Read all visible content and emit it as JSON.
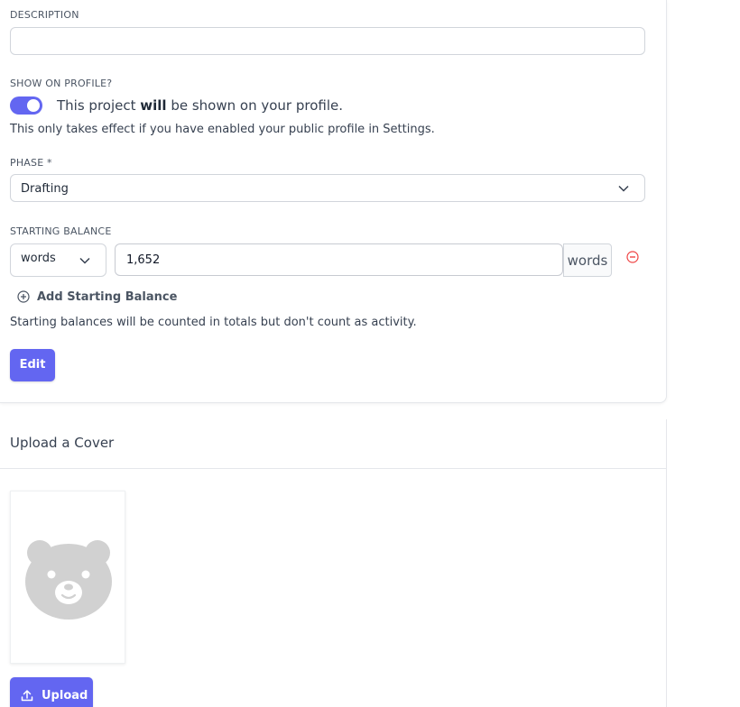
{
  "description": {
    "label": "DESCRIPTION",
    "value": "",
    "placeholder": ""
  },
  "profile": {
    "label": "SHOW ON PROFILE?",
    "toggle_on": true,
    "text_before": "This project",
    "text_bold": "will",
    "text_after": "be shown on your profile.",
    "note": "This only takes effect if you have enabled your public profile in Settings."
  },
  "phase": {
    "label": "PHASE *",
    "value": "Drafting"
  },
  "starting_balance": {
    "label": "STARTING BALANCE",
    "unit": "words",
    "amount": "1,652",
    "addon": "words",
    "add_label": "Add Starting Balance",
    "note": "Starting balances will be counted in totals but don't count as activity."
  },
  "edit_label": "Edit",
  "cover": {
    "title": "Upload a Cover",
    "upload_label": "Upload"
  },
  "colors": {
    "accent": "#6366f1",
    "danger": "#ef4444",
    "placeholder_bear": "#d1d1d1"
  }
}
